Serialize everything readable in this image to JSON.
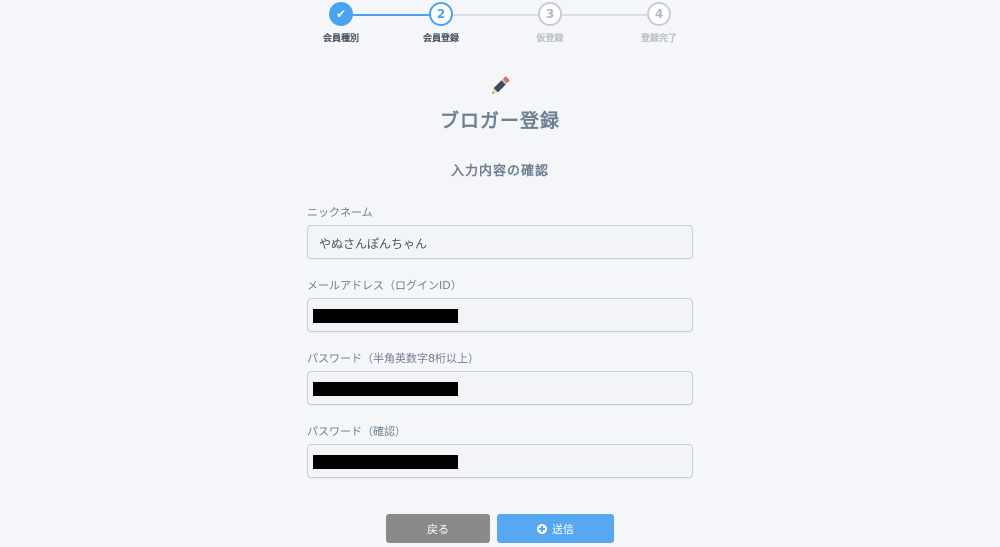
{
  "stepper": {
    "steps": [
      {
        "number": "✔",
        "label": "会員種別",
        "state": "done"
      },
      {
        "number": "2",
        "label": "会員登録",
        "state": "current"
      },
      {
        "number": "3",
        "label": "仮登録",
        "state": "todo"
      },
      {
        "number": "4",
        "label": "登録完了",
        "state": "todo"
      }
    ]
  },
  "header": {
    "icon": "pencil-icon",
    "title": "ブロガー登録",
    "subtitle": "入力内容の確認"
  },
  "form": {
    "nickname": {
      "label": "ニックネーム",
      "value": "やぬさんぽんちゃん"
    },
    "email": {
      "label": "メールアドレス（ログインID）",
      "value": "",
      "redacted": true
    },
    "password": {
      "label": "パスワード（半角英数字8桁以上）",
      "value": "",
      "redacted": true
    },
    "password_confirm": {
      "label": "パスワード（確認）",
      "value": "",
      "redacted": true
    }
  },
  "actions": {
    "back_label": "戻る",
    "send_label": "送信",
    "send_icon": "plus-circle-icon"
  },
  "colors": {
    "accent": "#4aa3f0",
    "back_button": "#8a8a8a",
    "send_button": "#57a7f3",
    "text": "#6e7f93"
  }
}
